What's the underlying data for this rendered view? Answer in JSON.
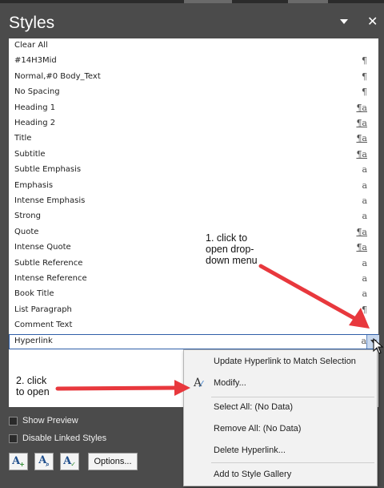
{
  "window": {
    "title": "Styles"
  },
  "styles": [
    {
      "name": "Clear All",
      "glyph": "",
      "underline": false
    },
    {
      "name": "#14H3Mid",
      "glyph": "¶",
      "underline": false
    },
    {
      "name": "Normal,#0 Body_Text",
      "glyph": "¶",
      "underline": false
    },
    {
      "name": "No Spacing",
      "glyph": "¶",
      "underline": false
    },
    {
      "name": "Heading 1",
      "glyph": "¶a",
      "underline": true
    },
    {
      "name": "Heading 2",
      "glyph": "¶a",
      "underline": true
    },
    {
      "name": "Title",
      "glyph": "¶a",
      "underline": true
    },
    {
      "name": "Subtitle",
      "glyph": "¶a",
      "underline": true
    },
    {
      "name": "Subtle Emphasis",
      "glyph": "a",
      "underline": false
    },
    {
      "name": "Emphasis",
      "glyph": "a",
      "underline": false
    },
    {
      "name": "Intense Emphasis",
      "glyph": "a",
      "underline": false
    },
    {
      "name": "Strong",
      "glyph": "a",
      "underline": false
    },
    {
      "name": "Quote",
      "glyph": "¶a",
      "underline": true
    },
    {
      "name": "Intense Quote",
      "glyph": "¶a",
      "underline": true
    },
    {
      "name": "Subtle Reference",
      "glyph": "a",
      "underline": false
    },
    {
      "name": "Intense Reference",
      "glyph": "a",
      "underline": false
    },
    {
      "name": "Book Title",
      "glyph": "a",
      "underline": false
    },
    {
      "name": "List Paragraph",
      "glyph": "¶",
      "underline": false
    },
    {
      "name": "Comment Text",
      "glyph": "",
      "underline": false
    },
    {
      "name": "Hyperlink",
      "glyph": "a",
      "underline": false,
      "selected": true
    }
  ],
  "options": {
    "show_preview": "Show Preview",
    "disable_linked": "Disable Linked Styles",
    "options_button": "Options..."
  },
  "context_menu": {
    "items": [
      {
        "label": "Update Hyperlink to Match Selection",
        "icon": ""
      },
      {
        "label": "Modify...",
        "icon": "modify-style-icon"
      },
      {
        "label": "Select All: (No Data)",
        "icon": ""
      },
      {
        "label": "Remove All: (No Data)",
        "icon": ""
      },
      {
        "label": "Delete Hyperlink...",
        "icon": ""
      },
      {
        "label": "Add to Style Gallery",
        "icon": ""
      }
    ]
  },
  "annotations": {
    "step1": [
      "1. click to",
      "open drop-",
      "down menu"
    ],
    "step2": [
      "2. click",
      "to open"
    ]
  },
  "colors": {
    "panel": "#4b4b4b",
    "arrow": "#e8383d",
    "selection_border": "#2f5fa8"
  }
}
